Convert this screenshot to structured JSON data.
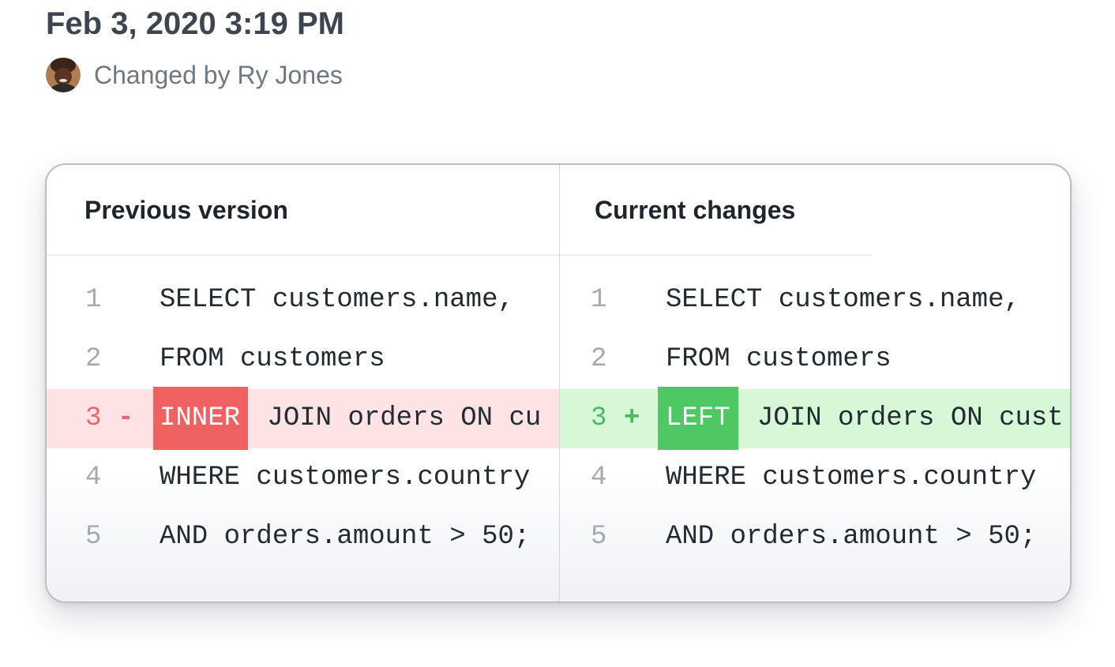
{
  "header": {
    "timestamp": "Feb 3, 2020 3:19 PM",
    "author_text": "Changed by Ry Jones"
  },
  "colors": {
    "removed_bg": "#fde3e3",
    "removed_accent": "#f06262",
    "added_bg": "#d7f8d7",
    "added_accent": "#4fc864"
  },
  "diff": {
    "previous": {
      "title": "Previous version",
      "lines": [
        {
          "number": "1",
          "marker": "",
          "token": "",
          "text": "SELECT customers.name,"
        },
        {
          "number": "2",
          "marker": "",
          "token": "",
          "text": "FROM customers"
        },
        {
          "number": "3",
          "marker": "-",
          "token": "INNER",
          "text": " JOIN orders ON cu"
        },
        {
          "number": "4",
          "marker": "",
          "token": "",
          "text": "WHERE customers.country"
        },
        {
          "number": "5",
          "marker": "",
          "token": "",
          "text": "AND orders.amount > 50;"
        }
      ]
    },
    "current": {
      "title": "Current changes",
      "lines": [
        {
          "number": "1",
          "marker": "",
          "token": "",
          "text": "SELECT customers.name,"
        },
        {
          "number": "2",
          "marker": "",
          "token": "",
          "text": "FROM customers"
        },
        {
          "number": "3",
          "marker": "+",
          "token": "LEFT",
          "text": " JOIN orders ON cust"
        },
        {
          "number": "4",
          "marker": "",
          "token": "",
          "text": "WHERE customers.country"
        },
        {
          "number": "5",
          "marker": "",
          "token": "",
          "text": "AND orders.amount > 50;"
        }
      ]
    }
  }
}
